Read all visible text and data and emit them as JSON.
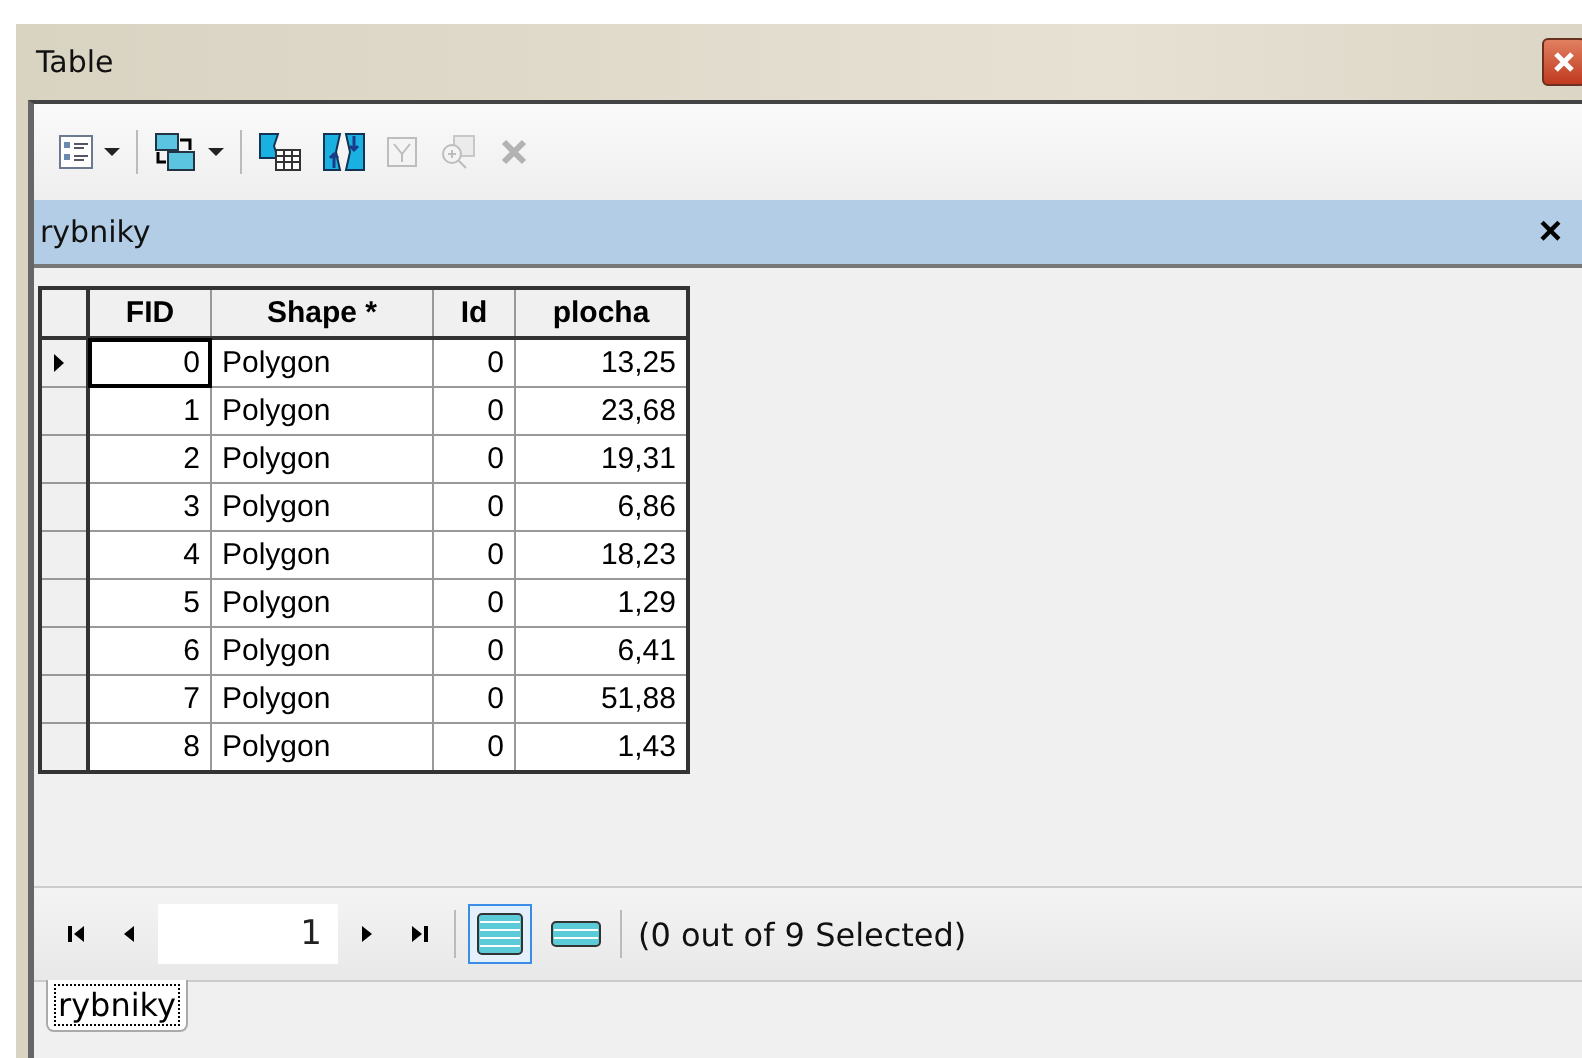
{
  "window": {
    "title": "Table"
  },
  "toolbar": [
    {
      "kind": "options",
      "dropdown": true,
      "disabled": false
    },
    {
      "kind": "related",
      "dropdown": true,
      "disabled": false
    },
    {
      "kind": "select-attr",
      "dropdown": false,
      "disabled": false
    },
    {
      "kind": "switch",
      "dropdown": false,
      "disabled": false
    },
    {
      "kind": "clear",
      "dropdown": false,
      "disabled": true
    },
    {
      "kind": "zoom",
      "dropdown": false,
      "disabled": true
    },
    {
      "kind": "delete",
      "dropdown": false,
      "disabled": true
    }
  ],
  "panel": {
    "title": "rybniky",
    "close": "×"
  },
  "table": {
    "columns": [
      "FID",
      "Shape *",
      "Id",
      "plocha"
    ],
    "rows": [
      {
        "cells": [
          "0",
          "Polygon",
          "0",
          "13,25"
        ],
        "current": true
      },
      {
        "cells": [
          "1",
          "Polygon",
          "0",
          "23,68"
        ],
        "current": false
      },
      {
        "cells": [
          "2",
          "Polygon",
          "0",
          "19,31"
        ],
        "current": false
      },
      {
        "cells": [
          "3",
          "Polygon",
          "0",
          "6,86"
        ],
        "current": false
      },
      {
        "cells": [
          "4",
          "Polygon",
          "0",
          "18,23"
        ],
        "current": false
      },
      {
        "cells": [
          "5",
          "Polygon",
          "0",
          "1,29"
        ],
        "current": false
      },
      {
        "cells": [
          "6",
          "Polygon",
          "0",
          "6,41"
        ],
        "current": false
      },
      {
        "cells": [
          "7",
          "Polygon",
          "0",
          "51,88"
        ],
        "current": false
      },
      {
        "cells": [
          "8",
          "Polygon",
          "0",
          "1,43"
        ],
        "current": false
      }
    ]
  },
  "navigation": {
    "record": "1",
    "views": [
      {
        "kind": "all",
        "selected": true
      },
      {
        "kind": "selected",
        "selected": false
      }
    ],
    "status": "(0 out of 9 Selected)"
  },
  "tabs": [
    {
      "label": "rybniky",
      "selected": true
    }
  ]
}
